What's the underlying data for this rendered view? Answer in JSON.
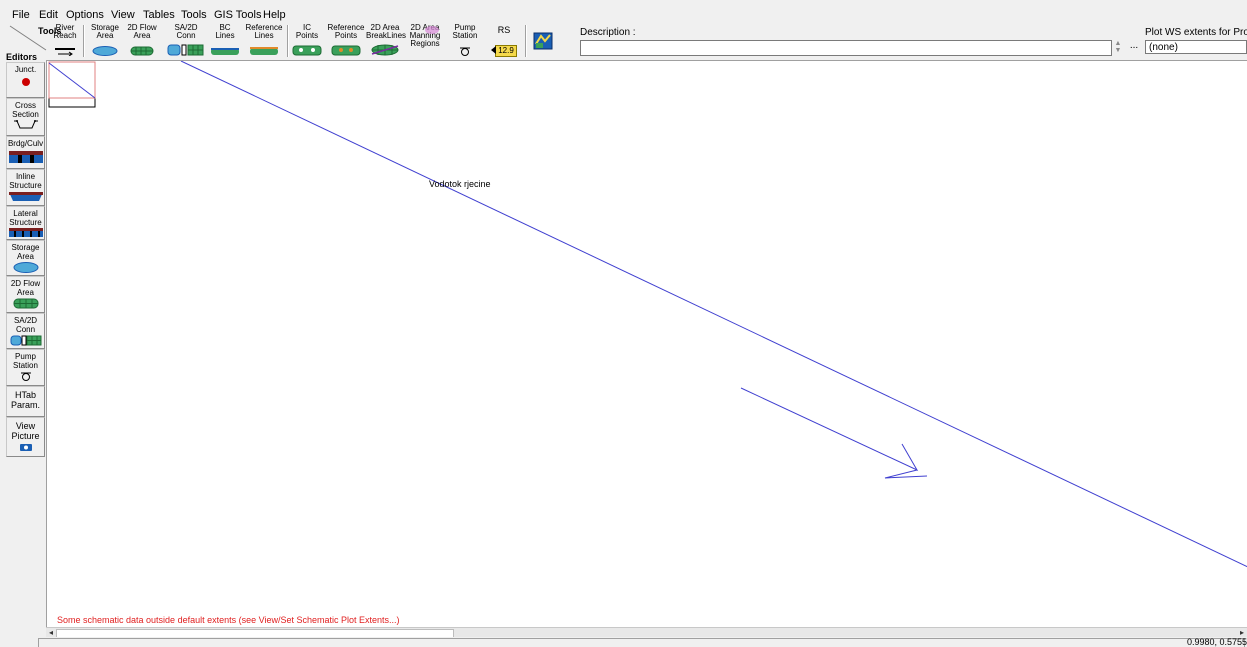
{
  "menu": [
    "File",
    "Edit",
    "Options",
    "View",
    "Tables",
    "Tools",
    "GIS Tools",
    "Help"
  ],
  "toolbar": {
    "tools_label": "Tools",
    "editors_label": "Editors",
    "buttons": [
      {
        "label": "River\nReach",
        "icon": "river-reach-icon"
      },
      {
        "label": "Storage\nArea",
        "icon": "storage-area-icon"
      },
      {
        "label": "2D Flow\nArea",
        "icon": "2d-flow-area-icon"
      },
      {
        "label": "SA/2D\nConn",
        "icon": "sa-2d-conn-icon"
      },
      {
        "label": "BC\nLines",
        "icon": "bc-lines-icon"
      },
      {
        "label": "Reference\nLines",
        "icon": "reference-lines-icon"
      },
      {
        "label": "IC\nPoints",
        "icon": "ic-points-icon"
      },
      {
        "label": "Reference\nPoints",
        "icon": "reference-points-icon"
      },
      {
        "label": "2D Area\nBreakLines",
        "icon": "breaklines-icon"
      },
      {
        "label": "2D Area\nManning\nRegions",
        "icon": "manning-regions-icon"
      },
      {
        "label": "Pump\nStation",
        "icon": "pump-station-icon"
      },
      {
        "label": "RS",
        "icon": "rs-icon"
      },
      {
        "label": "",
        "icon": "map-layers-icon"
      }
    ],
    "rs_value": "12.9",
    "description_label": "Description :",
    "description_value": "",
    "ellipsis": "...",
    "plot_ws_label": "Plot WS extents for Profile",
    "plot_ws_value": "(none)"
  },
  "editors": [
    {
      "label": "Junct.",
      "icon": "junction-icon"
    },
    {
      "label": "Cross\nSection",
      "icon": "cross-section-icon"
    },
    {
      "label": "Brdg/Culv",
      "icon": "bridge-culvert-icon"
    },
    {
      "label": "Inline\nStructure",
      "icon": "inline-structure-icon"
    },
    {
      "label": "Lateral\nStructure",
      "icon": "lateral-structure-icon"
    },
    {
      "label": "Storage\nArea",
      "icon": "storage-area-icon"
    },
    {
      "label": "2D Flow\nArea",
      "icon": "2d-flow-area-icon"
    },
    {
      "label": "SA/2D\nConn",
      "icon": "sa-2d-conn-icon"
    },
    {
      "label": "Pump\nStation",
      "icon": "pump-station-icon"
    },
    {
      "label": "HTab\nParam.",
      "icon": ""
    },
    {
      "label": "View\nPicture",
      "icon": "camera-icon"
    }
  ],
  "canvas": {
    "reach_name": "Vodotok rjecine",
    "warning": "Some schematic data outside default extents (see View/Set Schematic Plot Extents...)"
  },
  "status": {
    "coords": "0.9980, 0.5755"
  },
  "colors": {
    "reach": "#4040d0",
    "warning": "#e02020",
    "junction": "#cc0000",
    "accent_blue": "#1a5fb4"
  }
}
